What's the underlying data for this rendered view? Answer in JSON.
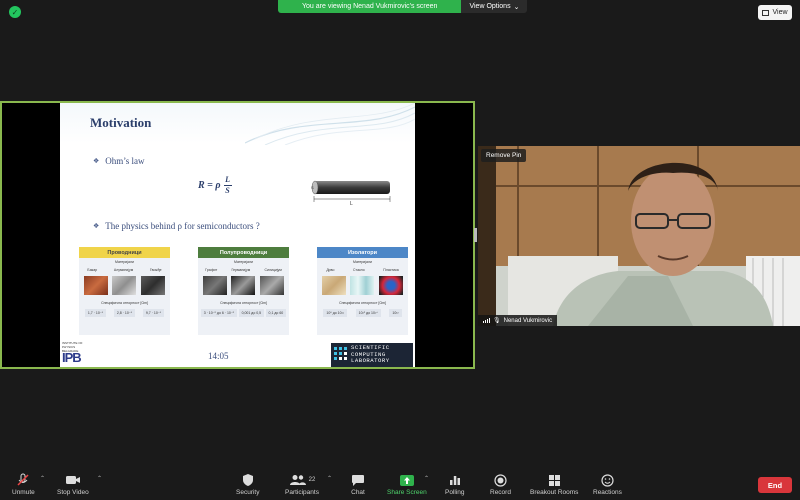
{
  "top": {
    "share_message": "You are viewing Nenad Vukmirovic's screen",
    "view_options": "View Options",
    "view_label": "View"
  },
  "slide": {
    "title": "Motivation",
    "bullet1": "Ohm’s law",
    "bullet2": "The physics behind ρ for semiconductors ?",
    "formula_lhs": "R = ρ",
    "formula_num": "L",
    "formula_den": "S",
    "rod_label": "L",
    "panels": [
      {
        "title": "Проводници",
        "color": "#f0d44a",
        "sub": "Материјали",
        "names": [
          "Бакар",
          "Алуминијум",
          "Гвожђе"
        ],
        "spec": "Специфична отпорност [Ωm]",
        "vals": [
          "1,7 · 10⁻⁸",
          "2,8 · 10⁻⁸",
          "9,7 · 10⁻⁸"
        ]
      },
      {
        "title": "Полупроводници",
        "color": "#4e7d3e",
        "sub": "Материјали",
        "names": [
          "Графит",
          "Германијум",
          "Силицијум"
        ],
        "spec": "Специфична отпорност [Ωm]",
        "vals": [
          "3 · 10⁻⁵ до 6 · 10⁻⁵",
          "0,001 до 0,5",
          "0,1 до 60"
        ]
      },
      {
        "title": "Изолатори",
        "color": "#4d87c7",
        "sub": "Материјали",
        "names": [
          "Дрво",
          "Стакло",
          "Пластика"
        ],
        "spec": "Специфична отпорност [Ωm]",
        "vals": [
          "10⁸ до 10¹¹",
          "10¹⁰ до 10¹⁴",
          "10¹³"
        ]
      }
    ],
    "time": "14:05",
    "ipb_text": "INSTITUTE OF PHYSICS BELGRADE",
    "ipb_logo": "IPB",
    "scl_lines": [
      "SCIENTIFIC",
      "COMPUTING",
      "LABORATORY"
    ]
  },
  "cam": {
    "remove_pin": "Remove Pin",
    "name": "Nenad Vukmirovic"
  },
  "toolbar": {
    "unmute": "Unmute",
    "stop_video": "Stop Video",
    "security": "Security",
    "participants": "Participants",
    "participants_count": "22",
    "chat": "Chat",
    "share_screen": "Share Screen",
    "polling": "Polling",
    "record": "Record",
    "breakout": "Breakout Rooms",
    "reactions": "Reactions",
    "end": "End"
  },
  "colors": {
    "share_green": "#2fb24c",
    "end_red": "#d9363b",
    "border_green": "#8ab84e"
  }
}
